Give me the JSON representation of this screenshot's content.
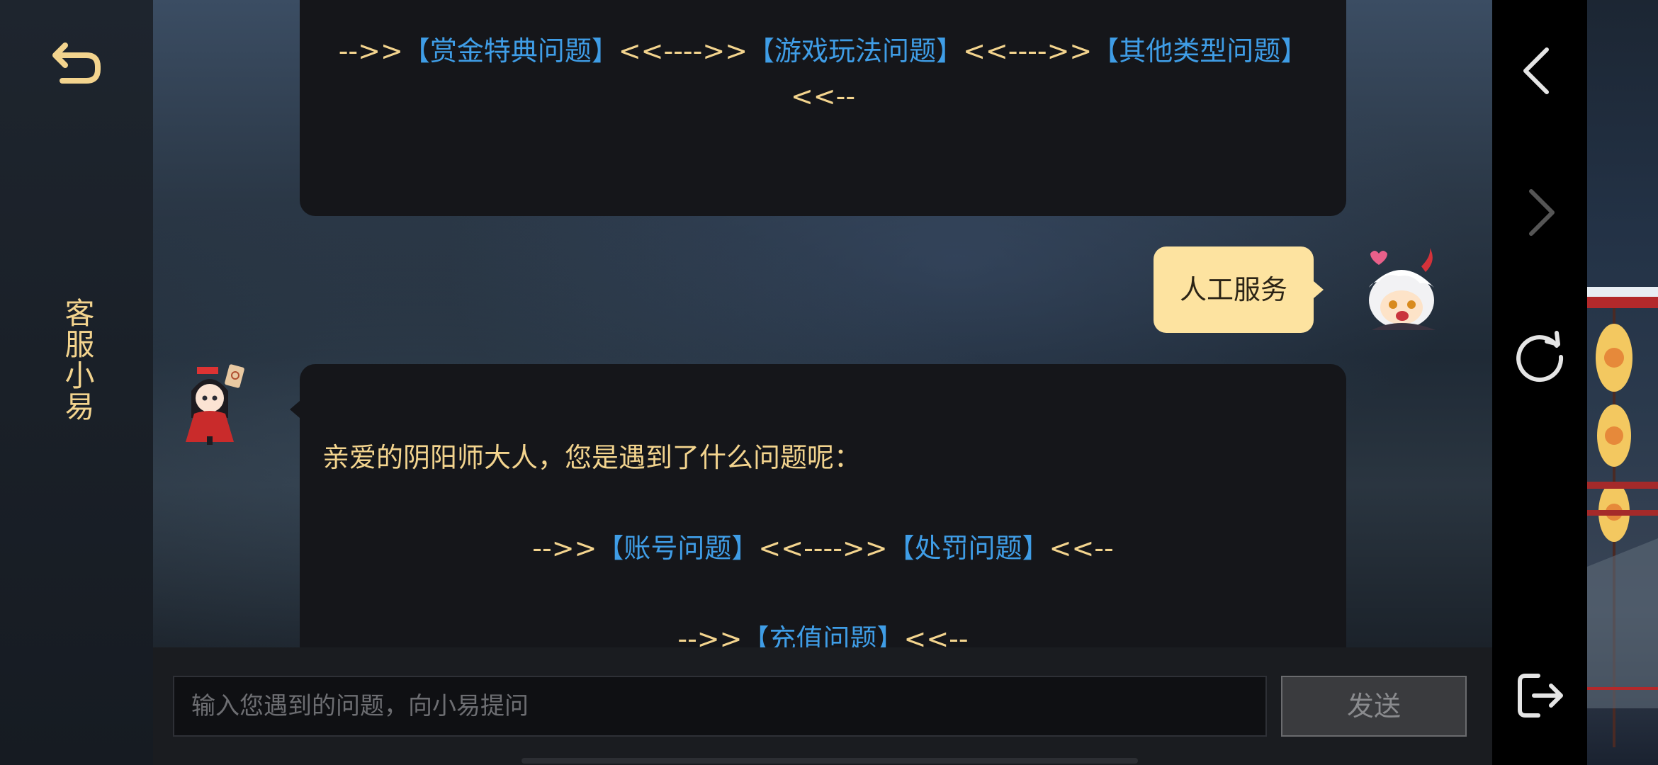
{
  "sidebar": {
    "title": "客服小易",
    "back_icon": "back-arrow-icon"
  },
  "chat": {
    "top_bubble": {
      "line1_prefix": "-->>",
      "link1": "【赏金特典问题】",
      "sep1": "<<---->>",
      "link2": "【游戏玩法问题】",
      "sep2": "<<---->>",
      "link3": "【其他类型问题】",
      "suffix": "<<--"
    },
    "user_message": "人工服务",
    "bot_message": {
      "greeting": "亲爱的阴阳师大人，您是遇到了什么问题呢：",
      "row1_prefix": "-->>",
      "row1_link1": "【账号问题】",
      "row1_sep": "<<---->>",
      "row1_link2": "【处罚问题】",
      "row1_suffix": "<<--",
      "row2_prefix": "-->>",
      "row2_link": "【充值问题】",
      "row2_suffix": "<<--"
    }
  },
  "input": {
    "placeholder": "输入您遇到的问题，向小易提问",
    "send_label": "发送"
  },
  "nav": {
    "back_icon": "chevron-left-icon",
    "forward_icon": "chevron-right-icon",
    "refresh_icon": "refresh-icon",
    "exit_icon": "exit-icon"
  },
  "colors": {
    "accent_gold": "#f3d48e",
    "link_blue": "#3f9de6",
    "bubble_dark": "#15161a",
    "user_bubble": "#fde3a0"
  }
}
